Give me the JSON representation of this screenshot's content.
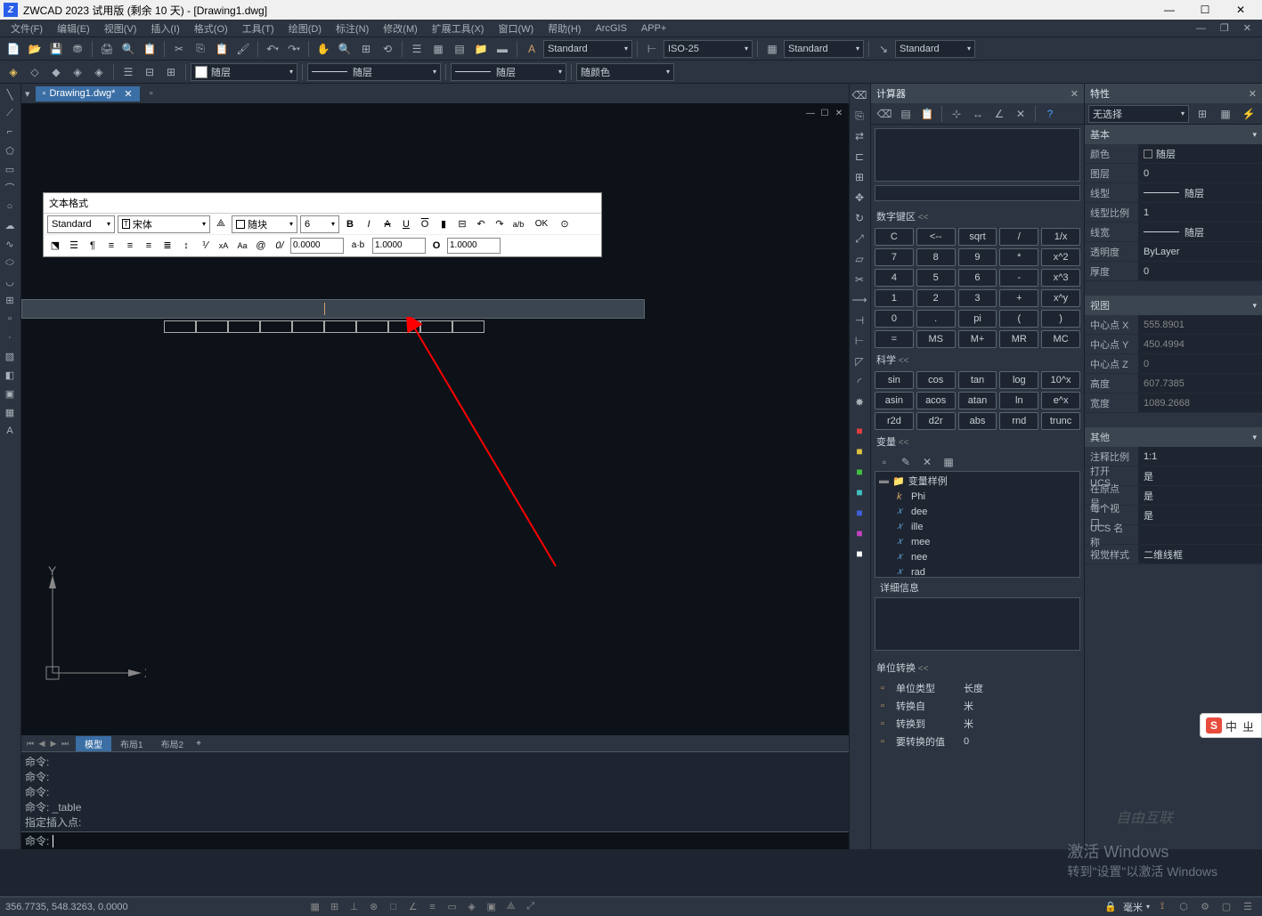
{
  "titlebar": {
    "app": "ZWCAD 2023 试用版 (剩余 10 天) - [Drawing1.dwg]"
  },
  "menus": [
    "文件(F)",
    "编辑(E)",
    "视图(V)",
    "插入(I)",
    "格式(O)",
    "工具(T)",
    "绘图(D)",
    "标注(N)",
    "修改(M)",
    "扩展工具(X)",
    "窗口(W)",
    "帮助(H)",
    "ArcGIS",
    "APP+"
  ],
  "toolbar_dropdowns": {
    "style1_label": "Standard",
    "style2_label": "ISO-25",
    "style3_label": "Standard",
    "style4_label": "Standard",
    "layer_label": "随层",
    "linetype_label": "随层",
    "lineweight_label": "随层",
    "color_label": "随颜色"
  },
  "doc_tab": {
    "name": "Drawing1.dwg*"
  },
  "text_format": {
    "title": "文本格式",
    "style": "Standard",
    "font": "宋体",
    "color": "随块",
    "size": "6",
    "ok": "OK",
    "bold": "B",
    "italic": "I",
    "strike": "A",
    "underline": "U",
    "overline": "O",
    "tracking": "0.0000",
    "width": "1.0000",
    "oblique": "1.0000",
    "ab": "a·b"
  },
  "layout_tabs": {
    "model": "模型",
    "layout1": "布局1",
    "layout2": "布局2"
  },
  "command_history": [
    "命令:",
    "命令:",
    "命令:",
    "命令: _table",
    "指定插入点:"
  ],
  "command_prompt": "命令:",
  "calculator": {
    "title": "计算器",
    "numpad_title": "数字键区",
    "numpad": [
      "C",
      "<--",
      "sqrt",
      "/",
      "1/x",
      "7",
      "8",
      "9",
      "*",
      "x^2",
      "4",
      "5",
      "6",
      "-",
      "x^3",
      "1",
      "2",
      "3",
      "+",
      "x^y",
      "0",
      ".",
      "pi",
      "(",
      ")",
      "=",
      "MS",
      "M+",
      "MR",
      "MC"
    ],
    "sci_title": "科学",
    "sci": [
      "sin",
      "cos",
      "tan",
      "log",
      "10^x",
      "asin",
      "acos",
      "atan",
      "ln",
      "e^x",
      "r2d",
      "d2r",
      "abs",
      "rnd",
      "trunc"
    ],
    "vars_title": "变量",
    "var_root": "变量样例",
    "vars": [
      "Phi",
      "dee",
      "ille",
      "mee",
      "nee",
      "rad"
    ],
    "detail_label": "详细信息",
    "unit_title": "单位转换",
    "unit_type": {
      "label": "单位类型",
      "value": "长度"
    },
    "from": {
      "label": "转换自",
      "value": "米"
    },
    "to": {
      "label": "转换到",
      "value": "米"
    },
    "input": {
      "label": "要转换的值",
      "value": "0"
    }
  },
  "properties": {
    "title": "特性",
    "no_selection": "无选择",
    "sections": {
      "basic": "基本",
      "view": "视图",
      "other": "其他"
    },
    "basic": {
      "color": {
        "label": "颜色",
        "value": "随层"
      },
      "layer": {
        "label": "图层",
        "value": "0"
      },
      "linetype": {
        "label": "线型",
        "value": "随层"
      },
      "ltscale": {
        "label": "线型比例",
        "value": "1"
      },
      "lineweight": {
        "label": "线宽",
        "value": "随层"
      },
      "transparency": {
        "label": "透明度",
        "value": "ByLayer"
      },
      "thickness": {
        "label": "厚度",
        "value": "0"
      }
    },
    "view": {
      "cx": {
        "label": "中心点 X",
        "value": "555.8901"
      },
      "cy": {
        "label": "中心点 Y",
        "value": "450.4994"
      },
      "cz": {
        "label": "中心点 Z",
        "value": "0"
      },
      "height": {
        "label": "高度",
        "value": "607.7385"
      },
      "width": {
        "label": "宽度",
        "value": "1089.2668"
      }
    },
    "other": {
      "annoscale": {
        "label": "注释比例",
        "value": "1:1"
      },
      "ucsopen": {
        "label": "打开 UCS...",
        "value": "是"
      },
      "origin": {
        "label": "在原点显...",
        "value": "是"
      },
      "perviewport": {
        "label": "每个视口...",
        "value": "是"
      },
      "ucsname": {
        "label": "UCS 名称",
        "value": ""
      },
      "visualstyle": {
        "label": "视觉样式",
        "value": "二维线框"
      }
    }
  },
  "statusbar": {
    "coords": "356.7735, 548.3263, 0.0000",
    "mm": "毫米"
  },
  "watermark": {
    "line1": "激活 Windows",
    "line2": "转到\"设置\"以激活 Windows"
  },
  "branding": "自由互联",
  "ime": "中",
  "ucs": {
    "x": "X",
    "y": "Y"
  }
}
